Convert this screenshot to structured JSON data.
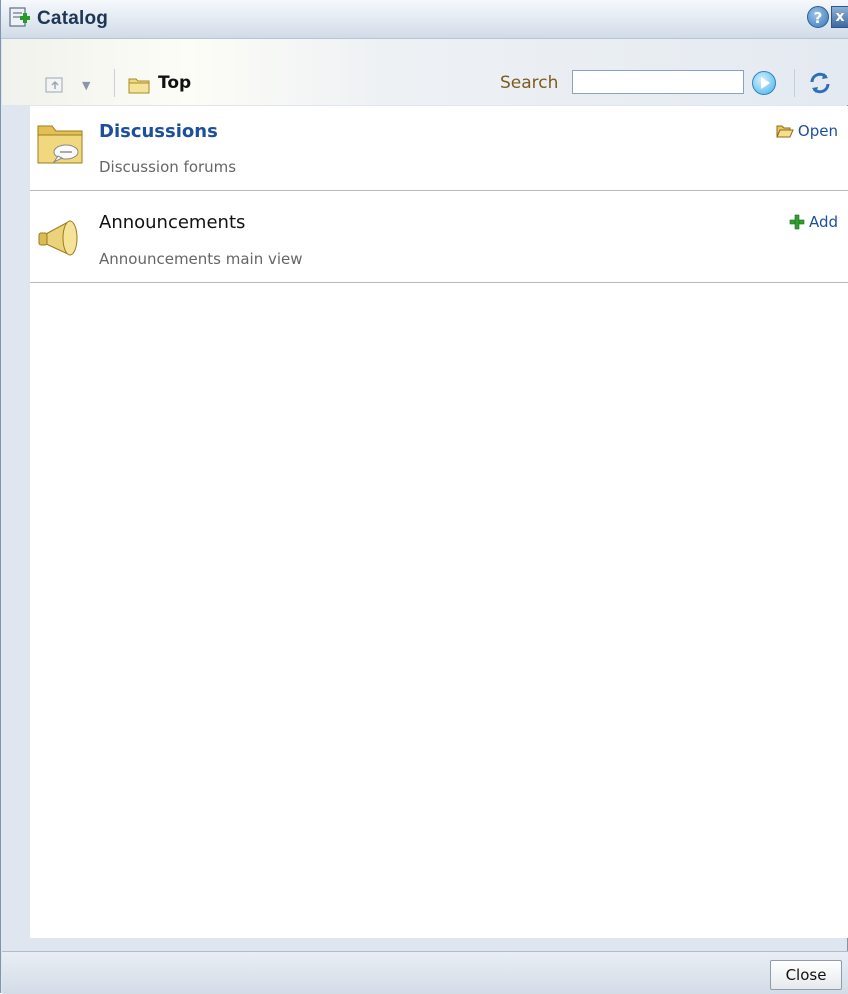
{
  "window": {
    "title": "Catalog",
    "help_label": "?",
    "close_label": "x"
  },
  "toolbar": {
    "breadcrumb_current": "Top",
    "search_label": "Search",
    "search_value": "",
    "search_placeholder": ""
  },
  "items": [
    {
      "title": "Discussions",
      "description": "Discussion forums",
      "action": "Open",
      "icon": "discussion-folder-icon"
    },
    {
      "title": "Announcements",
      "description": "Announcements main view",
      "action": "Add",
      "icon": "megaphone-icon"
    }
  ],
  "footer": {
    "close_label": "Close"
  },
  "colors": {
    "link": "#1c4f9c",
    "title_text": "#1e3553",
    "search_label": "#7c5b1e"
  }
}
